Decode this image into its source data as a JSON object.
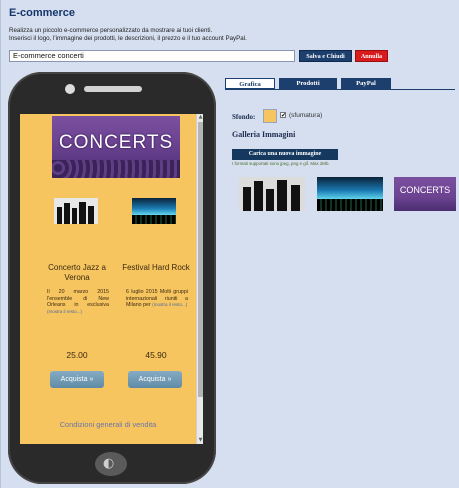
{
  "app": {
    "title": "E-commerce",
    "description_line1": "Realizza un piccolo e-commerce personalizzato da mostrare ai tuoi clienti.",
    "description_line2": "Inserisci il logo, l'immagine dei prodotti, le descrizioni, il prezzo e il tuo account PayPal."
  },
  "toolbar": {
    "name_value": "E-commerce concerti",
    "save_label": "Salva e Chiudi",
    "cancel_label": "Annulla"
  },
  "tabs": [
    {
      "label": "Grafica",
      "active": true
    },
    {
      "label": "Prodotti",
      "active": false
    },
    {
      "label": "PayPal",
      "active": false
    }
  ],
  "settings": {
    "background_label": "Sfondo:",
    "background_color": "#f7c560",
    "gradient_checked": true,
    "gradient_label": "(sfumatura)",
    "gallery_title": "Galleria Immagini",
    "upload_label": "Carica una nuova immagine",
    "formats_note": "I formati supportati sono jpeg, png e gif. Max 2Mb."
  },
  "preview": {
    "logo_text": "CONCERTS",
    "products": [
      {
        "title": "Concerto Jazz a Verona",
        "description": "Il 20 marzo 2015 l'ensemble di New Orleans in esclusiva",
        "more": "(mostra il resto...)",
        "price": "25.00",
        "buy_label": "Acquista »"
      },
      {
        "title": "Festival Hard Rock",
        "description": "6 luglio 2015 Molti gruppi internazionali riuniti a Milano per",
        "more": "(mostra il resto...)",
        "price": "45.90",
        "buy_label": "Acquista »"
      }
    ],
    "conditions": "Condizioni generali di vendita"
  },
  "gallery": {
    "thumb3_text": "CONCERTS"
  },
  "icons": {
    "home": "home-button-icon",
    "checkbox": "checkmark-icon"
  },
  "colors": {
    "accent": "#1d3f6e",
    "cancel": "#d91b1b",
    "screen_bg": "#f7c560"
  }
}
